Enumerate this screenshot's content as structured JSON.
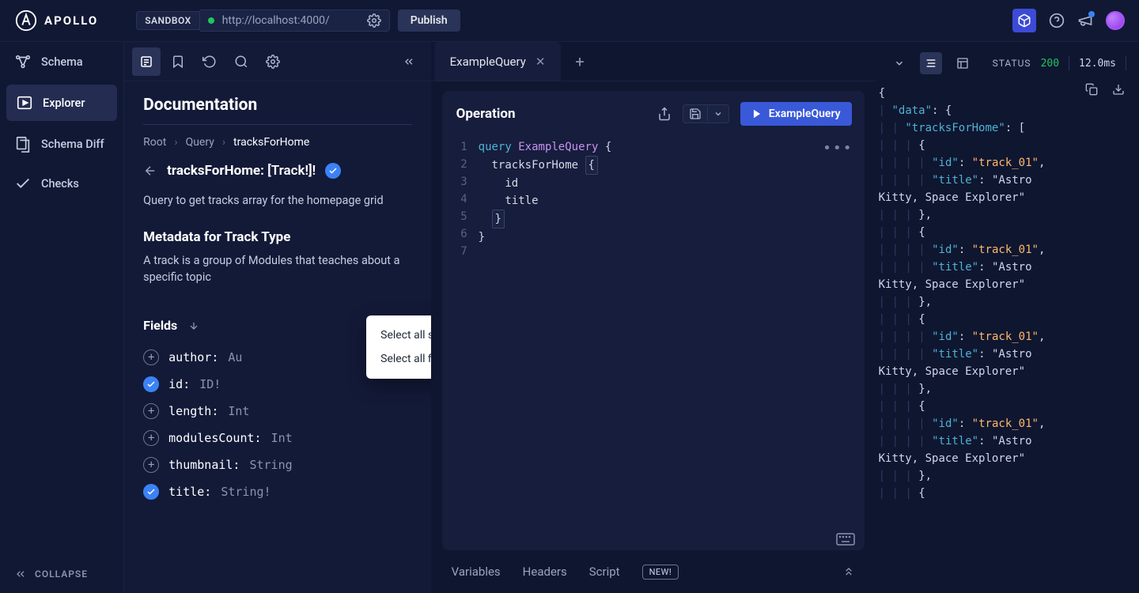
{
  "topbar": {
    "brand": "APOLLO",
    "sandbox_tag": "SANDBOX",
    "url": "http://localhost:4000/",
    "publish": "Publish"
  },
  "sidebar": {
    "items": [
      {
        "label": "Schema"
      },
      {
        "label": "Explorer"
      },
      {
        "label": "Schema Diff"
      },
      {
        "label": "Checks"
      }
    ],
    "collapse": "COLLAPSE"
  },
  "docs": {
    "title": "Documentation",
    "breadcrumb": [
      "Root",
      "Query",
      "tracksForHome"
    ],
    "field_name": "tracksForHome:",
    "field_return": "[Track!]!",
    "description": "Query to get tracks array for the homepage grid",
    "meta_heading": "Metadata for Track Type",
    "meta_desc": "A track is a group of Modules that teaches about a specific topic",
    "fields_label": "Fields",
    "menu": {
      "opt1": "Select all scalar fields",
      "opt2": "Select all fields recursively"
    },
    "fields": [
      {
        "name": "author:",
        "type": "Au",
        "selected": false
      },
      {
        "name": "id:",
        "type": "ID!",
        "selected": true
      },
      {
        "name": "length:",
        "type": "Int",
        "selected": false
      },
      {
        "name": "modulesCount:",
        "type": "Int",
        "selected": false
      },
      {
        "name": "thumbnail:",
        "type": "String",
        "selected": false
      },
      {
        "name": "title:",
        "type": "String!",
        "selected": true
      }
    ]
  },
  "operation": {
    "tab_label": "ExampleQuery",
    "panel_label": "Operation",
    "run_label": "ExampleQuery",
    "code": {
      "l1a": "query",
      "l1b": "ExampleQuery",
      "l1c": "{",
      "l2a": "tracksForHome",
      "l3": "id",
      "l4": "title"
    },
    "bottom": {
      "variables": "Variables",
      "headers": "Headers",
      "script": "Script",
      "new_badge": "NEW!"
    }
  },
  "response": {
    "status_label": "STATUS",
    "status_code": "200",
    "time": "12.0ms",
    "json_text": "{\n  \"data\": {\n    \"tracksForHome\": [\n      {\n        \"id\": \"track_01\",\n        \"title\": \"Astro\nKitty, Space Explorer\"\n      },\n      {\n        \"id\": \"track_01\",\n        \"title\": \"Astro\nKitty, Space Explorer\"\n      },\n      {\n        \"id\": \"track_01\",\n        \"title\": \"Astro\nKitty, Space Explorer\"\n      },\n      {\n        \"id\": \"track_01\",\n        \"title\": \"Astro\nKitty, Space Explorer\"\n      },\n      {"
  }
}
